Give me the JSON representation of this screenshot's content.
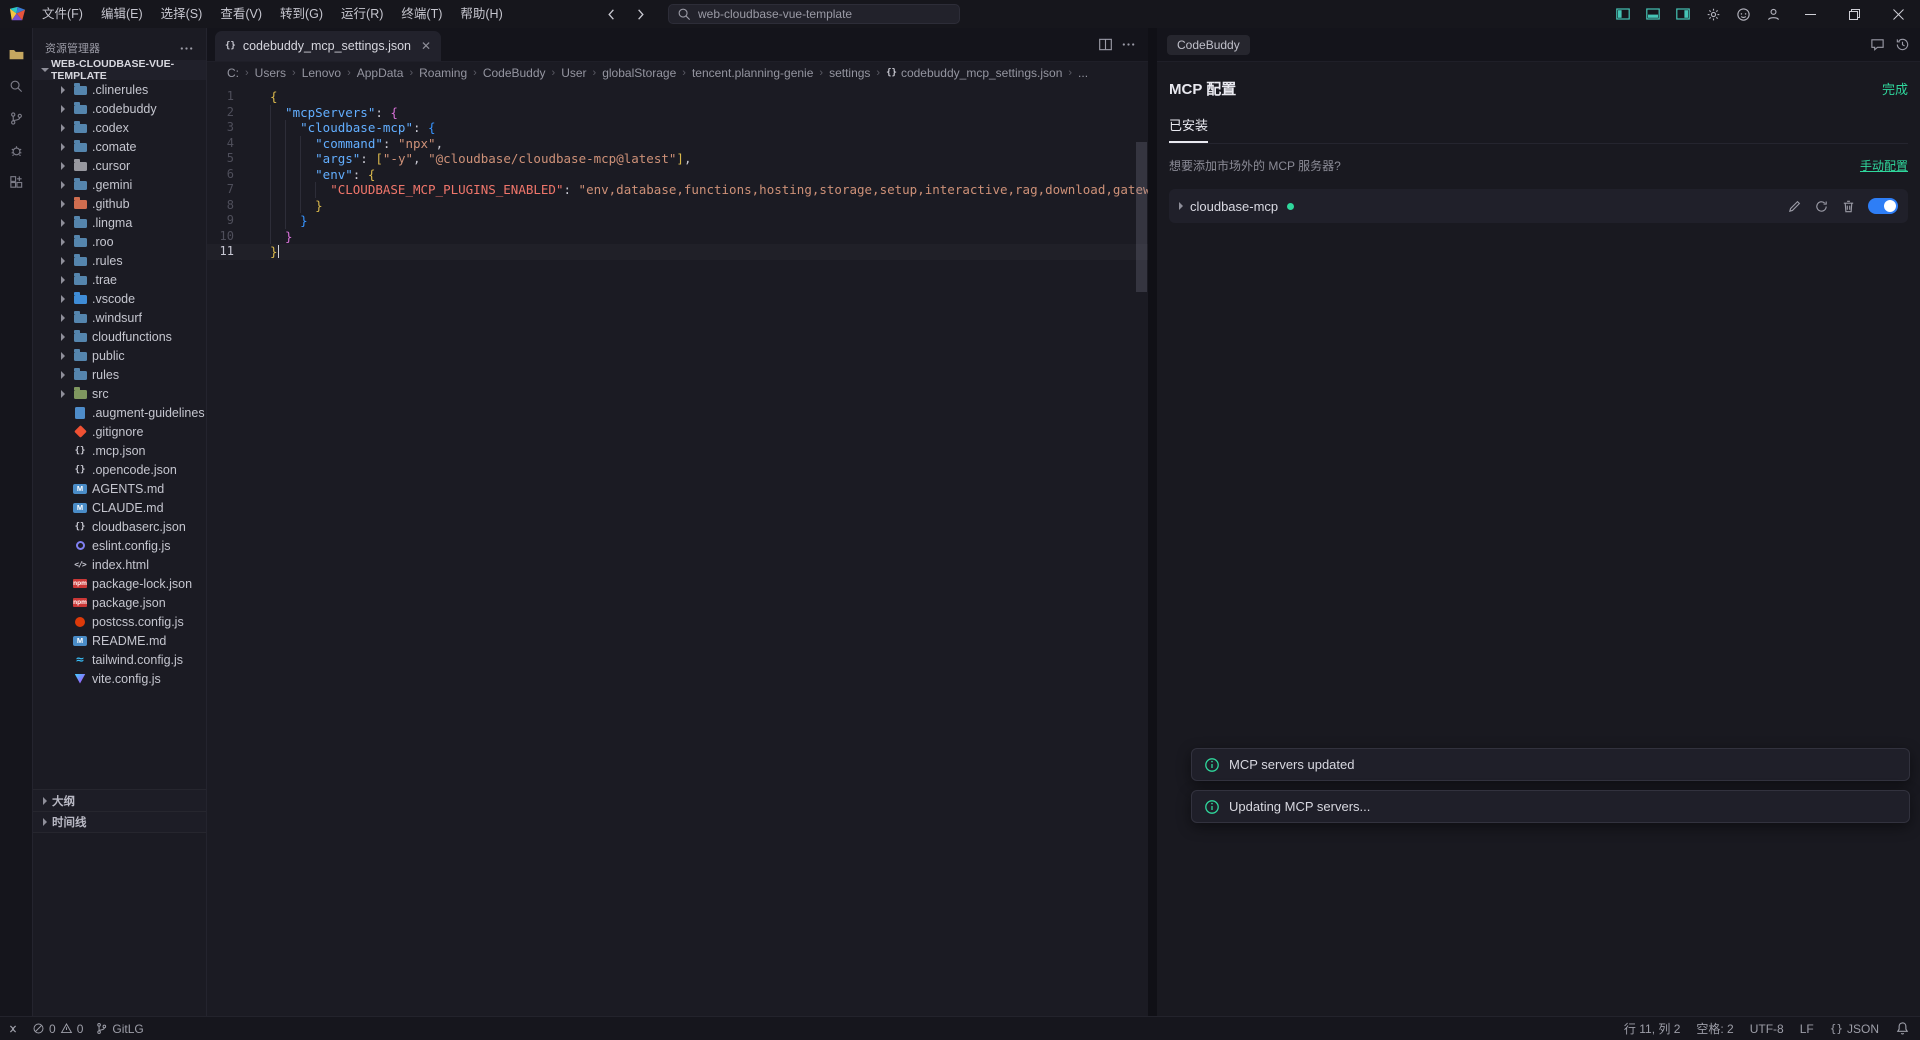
{
  "title_bar": {
    "menus": [
      "文件(F)",
      "编辑(E)",
      "选择(S)",
      "查看(V)",
      "转到(G)",
      "运行(R)",
      "终端(T)",
      "帮助(H)"
    ],
    "search_value": "web-cloudbase-vue-template",
    "nav_icons": [
      "back-arrow-icon",
      "forward-arrow-icon"
    ],
    "right_icons": [
      "layout-sidebar-left-icon",
      "layout-panel-bottom-icon",
      "layout-sidebar-right-icon",
      "settings-gear-icon",
      "copilot-icon",
      "account-icon"
    ],
    "window_controls": [
      "minimize-icon",
      "restore-icon",
      "close-icon"
    ]
  },
  "activity_bar": {
    "icons": [
      "explorer-icon",
      "search-icon",
      "source-control-icon",
      "debug-icon",
      "extensions-icon"
    ]
  },
  "sidebar": {
    "header": "资源管理器",
    "more_icon": "more-icon",
    "root_label": "WEB-CLOUDBASE-VUE-TEMPLATE",
    "items": [
      {
        "label": ".clinerules",
        "kind": "folder",
        "icon": "folder-icon",
        "color": "#5585ad"
      },
      {
        "label": ".codebuddy",
        "kind": "folder",
        "icon": "folder-icon",
        "color": "#5585ad"
      },
      {
        "label": ".codex",
        "kind": "folder",
        "icon": "folder-icon",
        "color": "#5585ad"
      },
      {
        "label": ".comate",
        "kind": "folder",
        "icon": "folder-icon",
        "color": "#5585ad"
      },
      {
        "label": ".cursor",
        "kind": "folder",
        "icon": "folder-icon",
        "color": "#98989f"
      },
      {
        "label": ".gemini",
        "kind": "folder",
        "icon": "folder-icon",
        "color": "#5585ad"
      },
      {
        "label": ".github",
        "kind": "folder",
        "icon": "folder-icon",
        "color": "#cf6d4f"
      },
      {
        "label": ".lingma",
        "kind": "folder",
        "icon": "folder-icon",
        "color": "#5585ad"
      },
      {
        "label": ".roo",
        "kind": "folder",
        "icon": "folder-icon",
        "color": "#5585ad"
      },
      {
        "label": ".rules",
        "kind": "folder",
        "icon": "folder-icon",
        "color": "#5585ad"
      },
      {
        "label": ".trae",
        "kind": "folder",
        "icon": "folder-icon",
        "color": "#5585ad"
      },
      {
        "label": ".vscode",
        "kind": "folder",
        "icon": "folder-icon",
        "color": "#3f8cd6"
      },
      {
        "label": ".windsurf",
        "kind": "folder",
        "icon": "folder-icon",
        "color": "#5585ad"
      },
      {
        "label": "cloudfunctions",
        "kind": "folder",
        "icon": "folder-icon",
        "color": "#5585ad"
      },
      {
        "label": "public",
        "kind": "folder",
        "icon": "folder-icon",
        "color": "#5585ad"
      },
      {
        "label": "rules",
        "kind": "folder",
        "icon": "folder-icon",
        "color": "#5585ad"
      },
      {
        "label": "src",
        "kind": "folder",
        "icon": "folder-icon",
        "color": "#7f975f"
      },
      {
        "label": ".augment-guidelines",
        "kind": "file",
        "icon": "file-icon",
        "color": "#4e8cc9"
      },
      {
        "label": ".gitignore",
        "kind": "file",
        "icon": "git-icon",
        "color": "#f05133"
      },
      {
        "label": ".mcp.json",
        "kind": "file",
        "icon": "json-icon",
        "color": "#c9c9d2"
      },
      {
        "label": ".opencode.json",
        "kind": "file",
        "icon": "json-icon",
        "color": "#c9c9d2"
      },
      {
        "label": "AGENTS.md",
        "kind": "file",
        "icon": "markdown-icon",
        "color": "#4a8cc7"
      },
      {
        "label": "CLAUDE.md",
        "kind": "file",
        "icon": "markdown-icon",
        "color": "#4a8cc7"
      },
      {
        "label": "cloudbaserc.json",
        "kind": "file",
        "icon": "json-icon",
        "color": "#c9c9d2"
      },
      {
        "label": "eslint.config.js",
        "kind": "file",
        "icon": "eslint-icon",
        "color": "#8080f2"
      },
      {
        "label": "index.html",
        "kind": "file",
        "icon": "html-icon",
        "color": "#c9c9d2"
      },
      {
        "label": "package-lock.json",
        "kind": "file",
        "icon": "npm-icon",
        "color": "#cb3837"
      },
      {
        "label": "package.json",
        "kind": "file",
        "icon": "npm-icon",
        "color": "#cb3837"
      },
      {
        "label": "postcss.config.js",
        "kind": "file",
        "icon": "postcss-icon",
        "color": "#dd3a0a"
      },
      {
        "label": "README.md",
        "kind": "file",
        "icon": "markdown-icon",
        "color": "#4a8cc7"
      },
      {
        "label": "tailwind.config.js",
        "kind": "file",
        "icon": "tailwind-icon",
        "color": "#38bdf8"
      },
      {
        "label": "vite.config.js",
        "kind": "file",
        "icon": "vite-icon",
        "color": "#9a66ff"
      }
    ],
    "bottom_panels": [
      "大纲",
      "时间线"
    ]
  },
  "editor": {
    "tab": {
      "icon": "json-icon",
      "label": "codebuddy_mcp_settings.json"
    },
    "tab_actions": [
      "split-editor-icon",
      "more-icon"
    ],
    "breadcrumbs": [
      "C:",
      "Users",
      "Lenovo",
      "AppData",
      "Roaming",
      "CodeBuddy",
      "User",
      "globalStorage",
      "tencent.planning-genie",
      "settings",
      "codebuddy_mcp_settings.json",
      "..."
    ],
    "lines": [
      [
        [
          "b1",
          "{"
        ]
      ],
      [
        [
          "ws",
          "  "
        ],
        [
          "key",
          "\"mcpServers\""
        ],
        [
          "pu",
          ": "
        ],
        [
          "b2",
          "{"
        ]
      ],
      [
        [
          "ws",
          "    "
        ],
        [
          "key",
          "\"cloudbase-mcp\""
        ],
        [
          "pu",
          ": "
        ],
        [
          "b3",
          "{"
        ]
      ],
      [
        [
          "ws",
          "      "
        ],
        [
          "key",
          "\"command\""
        ],
        [
          "pu",
          ": "
        ],
        [
          "str",
          "\"npx\""
        ],
        [
          "pu",
          ","
        ]
      ],
      [
        [
          "ws",
          "      "
        ],
        [
          "key",
          "\"args\""
        ],
        [
          "pu",
          ": "
        ],
        [
          "b1",
          "["
        ],
        [
          "str",
          "\"-y\""
        ],
        [
          "pu",
          ", "
        ],
        [
          "str",
          "\"@cloudbase/cloudbase-mcp@latest\""
        ],
        [
          "b1",
          "]"
        ],
        [
          "pu",
          ","
        ]
      ],
      [
        [
          "ws",
          "      "
        ],
        [
          "key",
          "\"env\""
        ],
        [
          "pu",
          ": "
        ],
        [
          "b1",
          "{"
        ]
      ],
      [
        [
          "ws",
          "        "
        ],
        [
          "key2",
          "\"CLOUDBASE_MCP_PLUGINS_ENABLED\""
        ],
        [
          "pu",
          ": "
        ],
        [
          "str",
          "\"env,database,functions,hosting,storage,setup,interactive,rag,download,gateway\""
        ]
      ],
      [
        [
          "ws",
          "      "
        ],
        [
          "b1",
          "}"
        ]
      ],
      [
        [
          "ws",
          "    "
        ],
        [
          "b3",
          "}"
        ]
      ],
      [
        [
          "ws",
          "  "
        ],
        [
          "b2",
          "}"
        ]
      ],
      [
        [
          "b1",
          "}"
        ]
      ]
    ],
    "cursor_line": 11
  },
  "right_panel": {
    "tab_label": "CodeBuddy",
    "header_icons": [
      "feedback-icon",
      "history-icon"
    ],
    "title": "MCP 配置",
    "done_button": "完成",
    "installed_tab": "已安装",
    "hint_text": "想要添加市场外的 MCP 服务器?",
    "manual_config_link": "手动配置",
    "servers": [
      {
        "name": "cloudbase-mcp",
        "status_color": "#2fd79c",
        "enabled": true,
        "actions": [
          "edit-icon",
          "refresh-icon",
          "delete-icon"
        ]
      }
    ]
  },
  "notifications": [
    {
      "icon": "info-icon",
      "text": "MCP servers updated"
    },
    {
      "icon": "info-icon",
      "text": "Updating MCP servers..."
    }
  ],
  "status_bar": {
    "remote_icon": "remote-icon",
    "errors": "0",
    "warnings": "0",
    "branch": "GitLG",
    "cursor_position": "行 11, 列 2",
    "indentation": "空格: 2",
    "encoding": "UTF-8",
    "eol": "LF",
    "language": "JSON"
  },
  "colors": {
    "accent_green": "#2fd79c",
    "accent_teal": "#45c4b5",
    "toggle_blue": "#2e7ef6"
  }
}
